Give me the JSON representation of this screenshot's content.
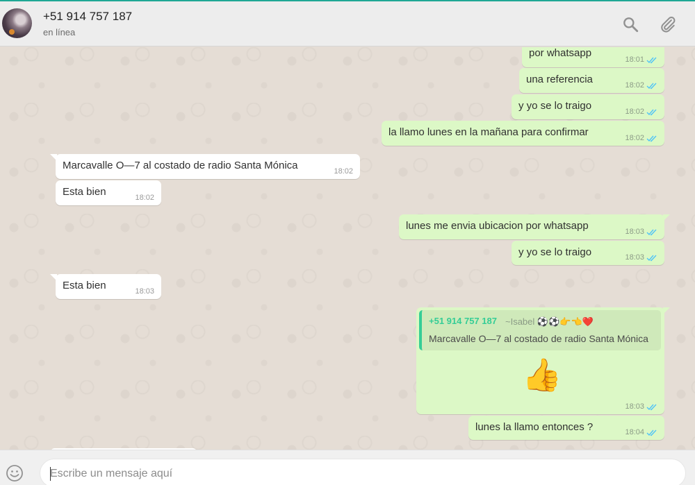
{
  "header": {
    "contact_name": "+51 914 757 187",
    "status": "en línea",
    "icons": [
      "search-icon",
      "attach-icon"
    ]
  },
  "messages": [
    {
      "dir": "out",
      "text": "por whatsapp",
      "time": "18:01"
    },
    {
      "dir": "out",
      "text": "una referencia",
      "time": "18:02"
    },
    {
      "dir": "out",
      "text": "y yo se lo traigo",
      "time": "18:02"
    },
    {
      "dir": "out",
      "text": "la llamo lunes en la mañana para confirmar",
      "time": "18:02"
    },
    {
      "dir": "in",
      "text": "Marcavalle O—7 al costado de radio Santa Mónica",
      "time": "18:02"
    },
    {
      "dir": "in",
      "text": "Esta bien",
      "time": "18:02"
    },
    {
      "dir": "out",
      "text": "lunes me envia ubicacion por whatsapp",
      "time": "18:03"
    },
    {
      "dir": "out",
      "text": "y yo se lo traigo",
      "time": "18:03"
    },
    {
      "dir": "in",
      "text": "Esta bien",
      "time": "18:03"
    },
    {
      "dir": "out",
      "time": "18:03",
      "quote": {
        "author": "+51 914 757 187",
        "author_alias": "~Isabel ⚽⚽👉👈❤️",
        "text": "Marcavalle O—7 al costado de radio Santa Mónica"
      },
      "emoji": "👍"
    },
    {
      "dir": "out",
      "text": "lunes la llamo entonces ?",
      "time": "18:04"
    }
  ],
  "footer": {
    "placeholder": "Escribe un mensaje aquí",
    "value": ""
  },
  "colors": {
    "accent": "#1fa895",
    "outgoing_bubble": "#dcf8c6",
    "incoming_bubble": "#ffffff",
    "read_ticks": "#4fc3f7",
    "quote_author": "#35cd96"
  }
}
